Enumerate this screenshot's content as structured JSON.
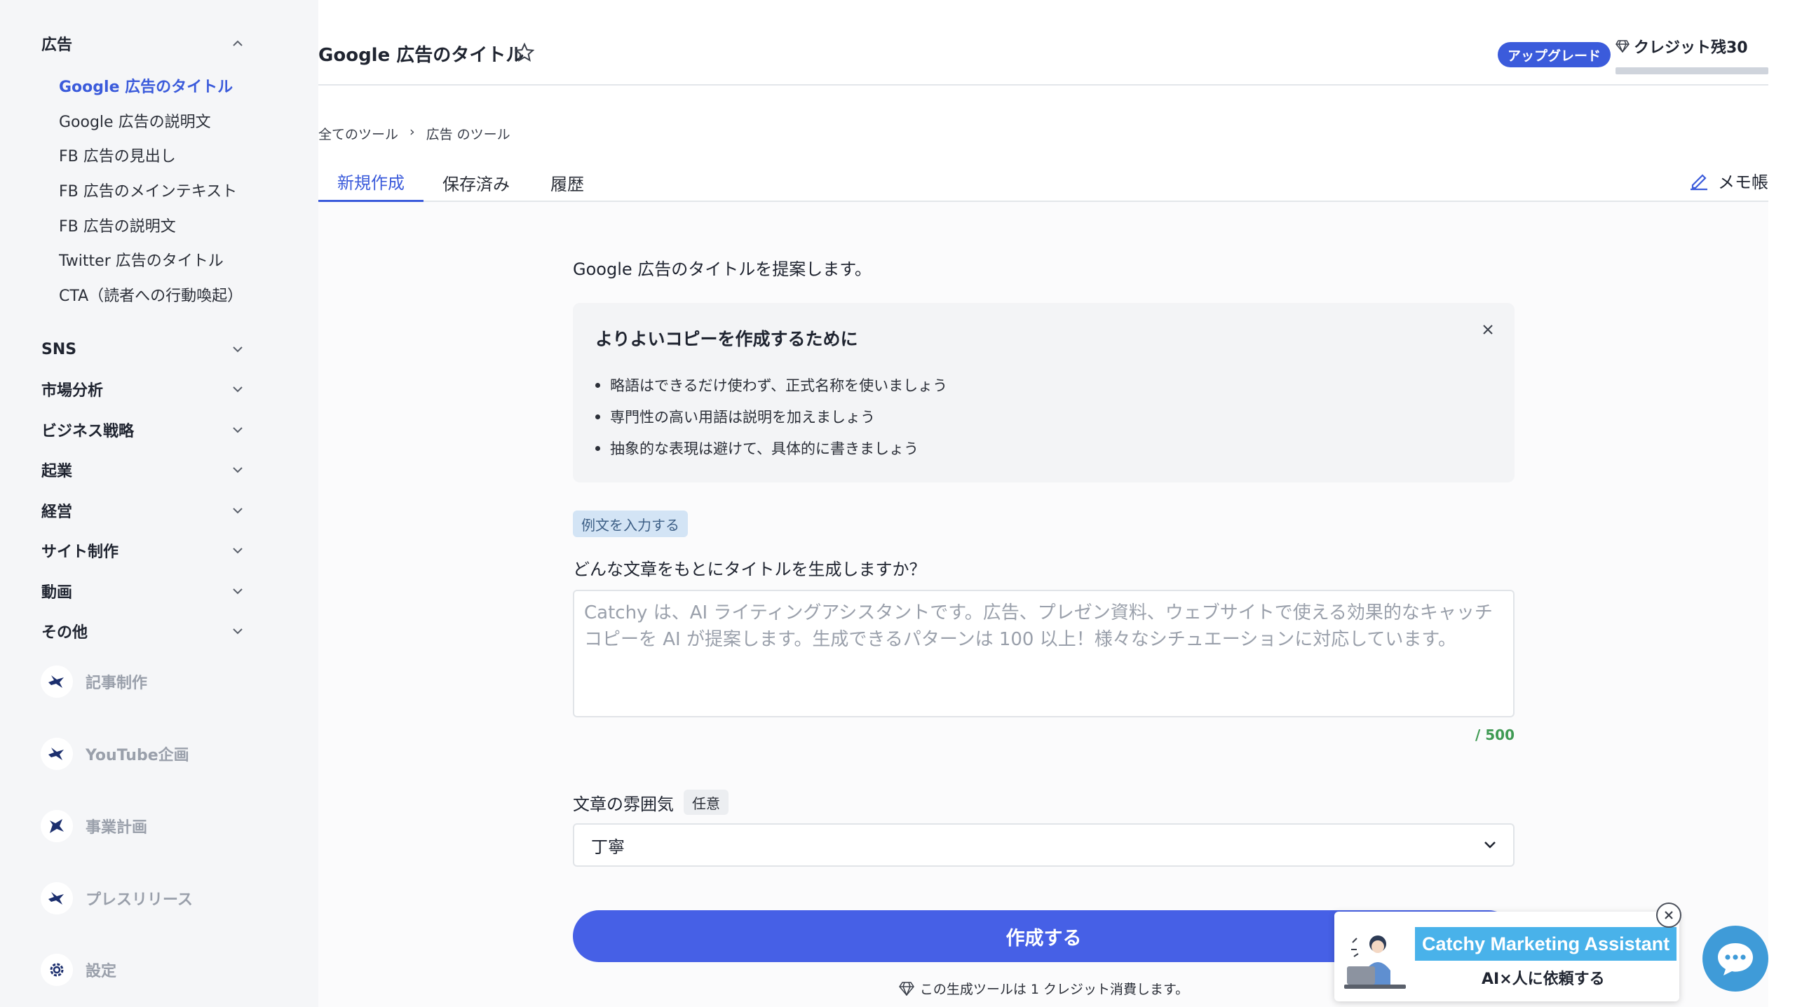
{
  "sidebar": {
    "categories": [
      {
        "label": "広告"
      },
      {
        "label": "SNS"
      },
      {
        "label": "市場分析"
      },
      {
        "label": "ビジネス戦略"
      },
      {
        "label": "起業"
      },
      {
        "label": "経営"
      },
      {
        "label": "サイト制作"
      },
      {
        "label": "動画"
      },
      {
        "label": "その他"
      }
    ],
    "ad_items": [
      {
        "label": "Google 広告のタイトル"
      },
      {
        "label": "Google 広告の説明文"
      },
      {
        "label": "FB 広告の見出し"
      },
      {
        "label": "FB 広告のメインテキスト"
      },
      {
        "label": "FB 広告の説明文"
      },
      {
        "label": "Twitter 広告のタイトル"
      },
      {
        "label": "CTA（読者への行動喚起）"
      }
    ],
    "tools": [
      {
        "label": "記事制作",
        "icon": "bird-icon"
      },
      {
        "label": "YouTube企画",
        "icon": "bird-icon"
      },
      {
        "label": "事業計画",
        "icon": "bird-icon"
      },
      {
        "label": "プレスリリース",
        "icon": "bird-icon"
      },
      {
        "label": "設定",
        "icon": "gear-icon"
      }
    ]
  },
  "header": {
    "title": "Google 広告のタイトル",
    "upgrade_label": "アップグレード",
    "credit_label": "クレジット残30",
    "accent": "#3b5bdb"
  },
  "breadcrumb": {
    "items": [
      "全てのツール",
      "広告 のツール"
    ],
    "separator": "›"
  },
  "tabs": [
    {
      "label": "新規作成"
    },
    {
      "label": "保存済み"
    },
    {
      "label": "履歴"
    }
  ],
  "memo_label": "メモ帳",
  "main": {
    "intro": "Google 広告のタイトルを提案します。",
    "tips": {
      "title": "よりよいコピーを作成するために",
      "items": [
        "略語はできるだけ使わず、正式名称を使いましょう",
        "専門性の高い用語は説明を加えましょう",
        "抽象的な表現は避けて、具体的に書きましょう"
      ]
    },
    "example_chip": "例文を入力する",
    "question": "どんな文章をもとにタイトルを生成しますか？",
    "source_placeholder": "Catchy は、AI ライティングアシスタントです。広告、プレゼン資料、ウェブサイトで使える効果的なキャッチコピーを AI が提案します。生成できるパターンは 100 以上！様々なシチュエーションに対応しています。",
    "char_count": "/ 500",
    "tone_label": "文章の雰囲気",
    "optional_badge": "任意",
    "tone_value": "丁寧",
    "create_label": "作成する",
    "cost_note": "この生成ツールは 1 クレジット消費します。"
  },
  "banner": {
    "title": "Catchy Marketing Assistant",
    "subtitle": "AI×人に依頼する"
  }
}
